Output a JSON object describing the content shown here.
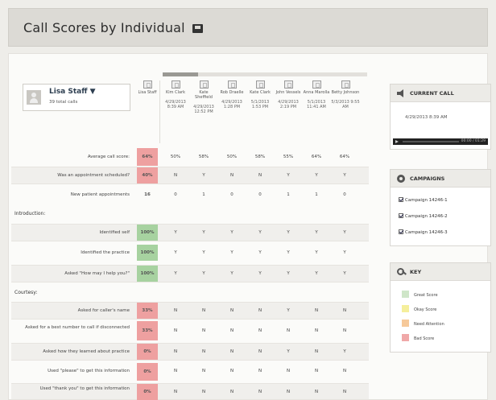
{
  "header": {
    "title": "Call Scores by Individual"
  },
  "user": {
    "name": "Lisa Staff ▼",
    "calls": "39 total calls"
  },
  "staff": [
    {
      "name": "Lisa Staff",
      "date": ""
    },
    {
      "name": "Kim Clark",
      "date": "4/29/2013 8:39 AM"
    },
    {
      "name": "Kate Sheffield",
      "date": "4/29/2013 12:52 PM"
    },
    {
      "name": "Rob Draelle",
      "date": "4/29/2013 1:28 PM"
    },
    {
      "name": "Kate Clark",
      "date": "5/1/2013 1:53 PM"
    },
    {
      "name": "John Vessels",
      "date": "4/29/2013 2:19 PM"
    },
    {
      "name": "Anna Marolla",
      "date": "5/1/2013 11:41 AM"
    },
    {
      "name": "Betty Johnson",
      "date": "5/3/2013 9:55 AM"
    }
  ],
  "rows": [
    {
      "label": "Average call score:",
      "score": "64%",
      "cells": [
        "50%",
        "58%",
        "50%",
        "58%",
        "55%",
        "64%",
        "64%"
      ]
    },
    {
      "label": "Was an appointment scheduled?",
      "score": "40%",
      "cells": [
        "N",
        "Y",
        "N",
        "N",
        "Y",
        "Y",
        "Y"
      ]
    },
    {
      "label": "New patient appointments",
      "score": "16",
      "cells": [
        "0",
        "1",
        "0",
        "0",
        "1",
        "1",
        "0"
      ]
    },
    {
      "label": "Identified self",
      "score": "100%",
      "cells": [
        "Y",
        "Y",
        "Y",
        "Y",
        "Y",
        "Y",
        "Y"
      ]
    },
    {
      "label": "Identified the practice",
      "score": "100%",
      "cells": [
        "Y",
        "Y",
        "Y",
        "Y",
        "Y",
        "Y",
        "Y"
      ]
    },
    {
      "label": "Asked \"How may I help you?\"",
      "score": "100%",
      "cells": [
        "Y",
        "Y",
        "Y",
        "Y",
        "Y",
        "Y",
        "Y"
      ]
    },
    {
      "label": "Asked for caller's name",
      "score": "33%",
      "cells": [
        "N",
        "N",
        "N",
        "N",
        "Y",
        "N",
        "N"
      ]
    },
    {
      "label": "Asked for a best number to call if disconnected",
      "score": "33%",
      "cells": [
        "N",
        "N",
        "N",
        "N",
        "N",
        "N",
        "N"
      ]
    },
    {
      "label": "Asked how they learned about practice",
      "score": "0%",
      "cells": [
        "N",
        "N",
        "N",
        "N",
        "Y",
        "N",
        "Y"
      ]
    },
    {
      "label": "Used \"please\" to get this information",
      "score": "0%",
      "cells": [
        "N",
        "N",
        "N",
        "N",
        "N",
        "N",
        "N"
      ]
    },
    {
      "label": "Used \"thank you\" to get this information",
      "score": "0%",
      "cells": [
        "N",
        "N",
        "N",
        "N",
        "N",
        "N",
        "N"
      ]
    }
  ],
  "sections": {
    "introduction": "Introduction:",
    "courtesy": "Courtesy:"
  },
  "current_call": {
    "title": "CURRENT CALL",
    "datetime": "4/29/2013 8:39 AM",
    "player_time": "00:00 / 01:29"
  },
  "campaigns": {
    "title": "CAMPAIGNS",
    "items": [
      "Campaign 14246-1",
      "Campaign 14246-2",
      "Campaign 14246-3"
    ]
  },
  "key": {
    "title": "KEY",
    "items": [
      {
        "label": "Great Score",
        "color": "#cfe6c8"
      },
      {
        "label": "Okay Score",
        "color": "#f5ef9c"
      },
      {
        "label": "Need Attention",
        "color": "#f6c99a"
      },
      {
        "label": "Bad Score",
        "color": "#f0a8a8"
      }
    ]
  }
}
